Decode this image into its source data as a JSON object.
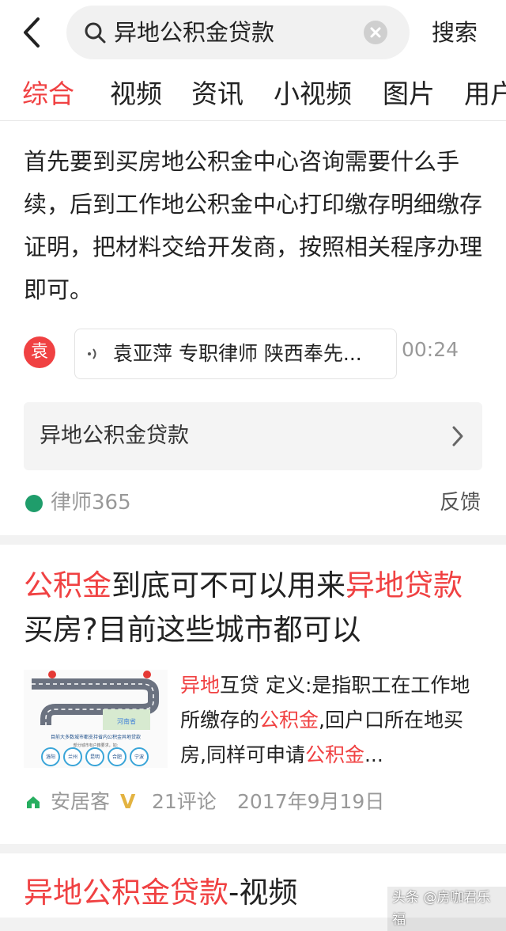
{
  "search": {
    "query": "异地公积金贷款",
    "button_label": "搜索"
  },
  "tabs": [
    {
      "label": "综合",
      "active": true
    },
    {
      "label": "视频"
    },
    {
      "label": "资讯"
    },
    {
      "label": "小视频"
    },
    {
      "label": "图片"
    },
    {
      "label": "用户"
    }
  ],
  "answer_card": {
    "text": "首先要到买房地公积金中心咨询需要什么手续，后到工作地公积金中心打印缴存明细缴存证明，把材料交给开发商，按照相关程序办理即可。",
    "avatar_char": "袁",
    "audio_label": "袁亚萍 专职律师 陕西奉先...",
    "duration": "00:24",
    "related_query": "异地公积金贷款",
    "source": "律师365",
    "feedback": "反馈"
  },
  "article_card": {
    "title_parts": [
      {
        "text": "公积金",
        "hl": true
      },
      {
        "text": "到底可不可以用来",
        "hl": false
      },
      {
        "text": "异地贷款",
        "hl": true
      },
      {
        "text": "买房?目前这些城市都可以",
        "hl": false
      }
    ],
    "snippet_parts": [
      {
        "text": "异地",
        "hl": true
      },
      {
        "text": "互贷 定义:是指职工在工作地所缴存的",
        "hl": false
      },
      {
        "text": "公积金",
        "hl": true
      },
      {
        "text": ",回户口所在地买房,同样可申请",
        "hl": false
      },
      {
        "text": "公积金",
        "hl": true
      },
      {
        "text": "...",
        "hl": false
      }
    ],
    "thumbnail": {
      "map_label": "河南省",
      "caption": "目前大多数城市都支持省内公积金异地贷款",
      "sub_caption": "部分城市有户籍要求，如:",
      "cities": [
        "洛阳",
        "兰州",
        "昆明",
        "合肥",
        "宁波"
      ]
    },
    "source": "安居客",
    "verified_badge": "V",
    "comments": "21评论",
    "date": "2017年9月19日"
  },
  "video_card": {
    "title_parts": [
      {
        "text": "异地公积金贷款",
        "hl": true
      },
      {
        "text": "-视频",
        "hl": false
      }
    ]
  },
  "watermark": "头条 @房咖君乐福",
  "colors": {
    "accent": "#f04142",
    "muted": "#999999"
  }
}
